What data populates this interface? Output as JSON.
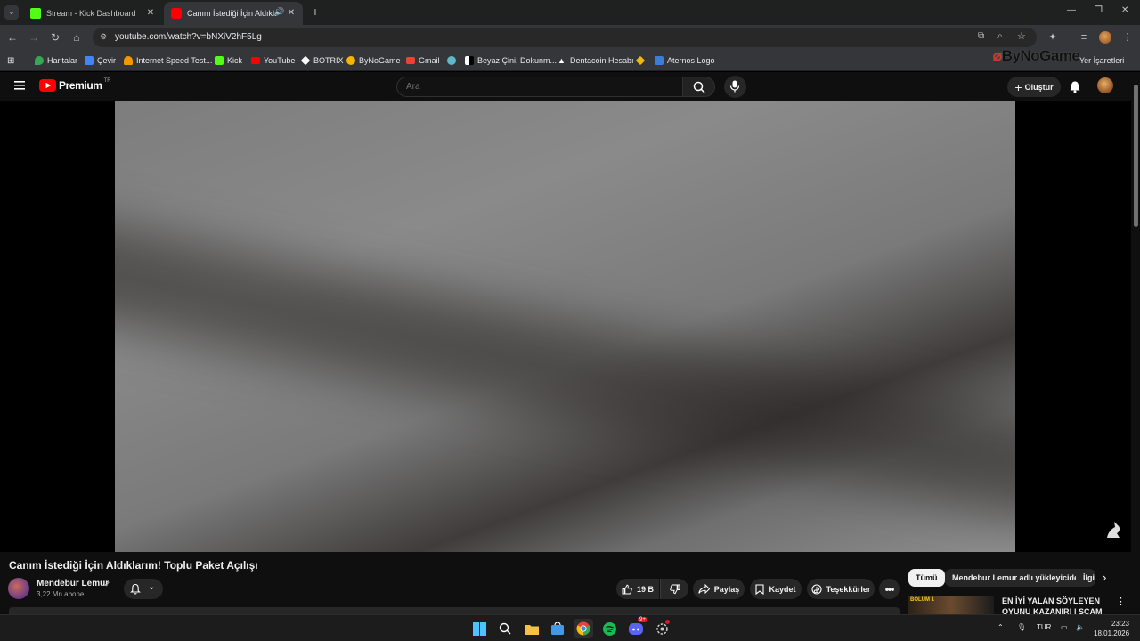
{
  "browser": {
    "tabs": [
      {
        "title": "Stream - Kick Dashboard",
        "favicon_color": "#53fc18"
      },
      {
        "title": "Canım İstediği İçin Aldıklarım",
        "favicon_color": "#ff0000"
      }
    ],
    "new_tab_label": "+",
    "url": "youtube.com/watch?v=bNXiV2hF5Lg",
    "bookmarks": [
      {
        "label": "Haritalar",
        "color": "#34a853"
      },
      {
        "label": "Çevir",
        "color": "#4285f4"
      },
      {
        "label": "Internet Speed Test...",
        "color": "#f29900"
      },
      {
        "label": "Kick",
        "color": "#53fc18"
      },
      {
        "label": "YouTube",
        "color": "#ff0000"
      },
      {
        "label": "BOTRIX",
        "color": "#ffffff"
      },
      {
        "label": "ByNoGame",
        "color": "#f5b400"
      },
      {
        "label": "Gmail",
        "color": "#ea4335"
      },
      {
        "label": "",
        "color": "#5fb8c9"
      },
      {
        "label": "Beyaz Çini, Dokunm...",
        "color": "#ffffff"
      },
      {
        "label": "Dentacoin Hesabı",
        "color": "#ffffff"
      },
      {
        "label": "",
        "color": "#f0b90b"
      },
      {
        "label": "Aternos Logo",
        "color": "#3b7dd8"
      }
    ],
    "other_bookmarks": "Yer İşaretleri"
  },
  "youtube": {
    "logo_text": "Premium",
    "logo_region": "TR",
    "search_placeholder": "Ara",
    "create_label": "Oluştur"
  },
  "watermark": {
    "text": "ByNoGame"
  },
  "video": {
    "title": "Canım İstediği İçin Aldıklarım! Toplu Paket Açılışı",
    "channel": "Mendebur Lemur",
    "subscribers": "3,22 Mn abone",
    "likes": "19 B",
    "share_label": "Paylaş",
    "save_label": "Kaydet",
    "thanks_label": "Teşekkürler"
  },
  "recommendations": {
    "chips": [
      "Tümü",
      "Mendebur Lemur adlı yükleyiciden",
      "İlgili"
    ],
    "first_title": "EN İYİ YALAN SÖYLEYEN OYUNU KAZANIR! | SCAM LIN",
    "first_thumb_tag": "BÖLÜM 1"
  },
  "taskbar": {
    "language": "TUR",
    "time": "23:23",
    "date": "18.01.2026",
    "discord_badge": "9+",
    "colors": {
      "windows": "#4cc2ff",
      "folder": "#f6c143",
      "store": "#3f9be8",
      "chrome": "#4285f4",
      "spotify": "#1db954",
      "discord": "#5865f2"
    }
  }
}
